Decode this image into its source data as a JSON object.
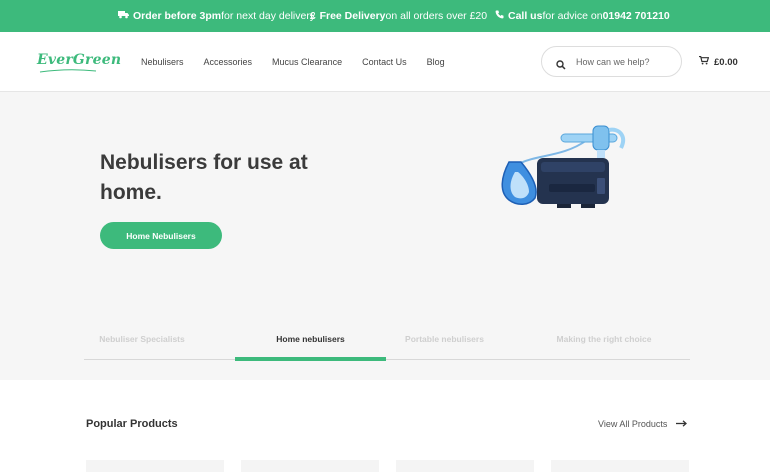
{
  "promo_bar": {
    "item1": {
      "bold": "Order before 3pm",
      "rest": " for next day delivery",
      "icon": "truck-icon"
    },
    "item2": {
      "bold": "Free Delivery",
      "rest": " on all orders over £20",
      "icon": "pound-icon",
      "symbol": "£"
    },
    "item3": {
      "bold": "Call us",
      "rest": " for advice on ",
      "phone": "01942 701210",
      "icon": "phone-icon"
    }
  },
  "header": {
    "logo": "EverGreen",
    "nav": [
      "Nebulisers",
      "Accessories",
      "Mucus Clearance",
      "Contact Us",
      "Blog"
    ],
    "search_placeholder": "How can we help?",
    "cart_total": "£0.00"
  },
  "hero": {
    "title": "Nebulisers for use at home.",
    "button": "Home Nebulisers",
    "image": "nebuliser-product-image"
  },
  "tabs": [
    {
      "label": "Nebuliser Specialists",
      "active": false
    },
    {
      "label": "Home nebulisers",
      "active": true
    },
    {
      "label": "Portable nebulisers",
      "active": false
    },
    {
      "label": "Making the right choice",
      "active": false
    }
  ],
  "popular": {
    "title": "Popular Products",
    "view_all": "View All Products"
  },
  "colors": {
    "brand_green": "#3dba7c",
    "hero_bg": "#f6f6f6",
    "text_dark": "#333333"
  }
}
